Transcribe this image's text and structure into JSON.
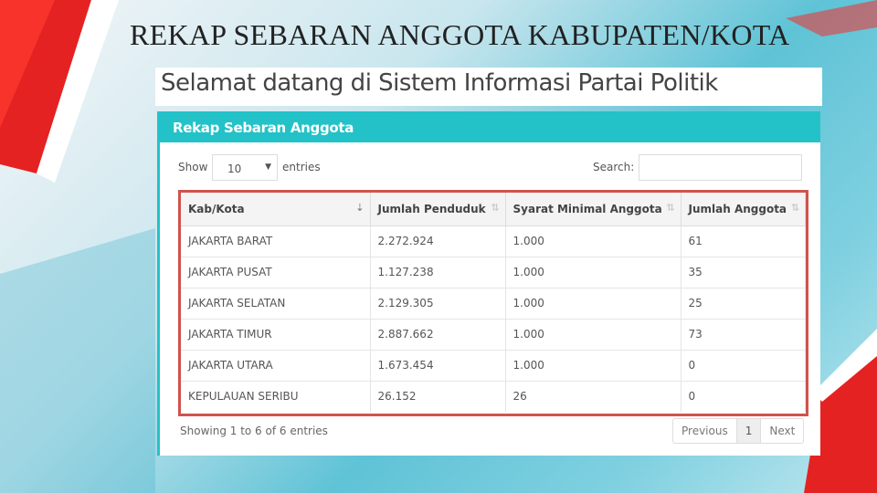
{
  "slide_title": "REKAP SEBARAN ANGGOTA  KABUPATEN/KOTA",
  "welcome": "Selamat datang di Sistem Informasi Partai Politik",
  "panel": {
    "title": "Rekap Sebaran Anggota",
    "show_label": "Show",
    "page_size": "10",
    "entries_label": "entries",
    "search_label": "Search:",
    "search_value": ""
  },
  "table": {
    "headers": [
      "Kab/Kota",
      "Jumlah Penduduk",
      "Syarat Minimal Anggota",
      "Jumlah Anggota"
    ],
    "rows": [
      [
        "JAKARTA BARAT",
        "2.272.924",
        "1.000",
        "61"
      ],
      [
        "JAKARTA PUSAT",
        "1.127.238",
        "1.000",
        "35"
      ],
      [
        "JAKARTA SELATAN",
        "2.129.305",
        "1.000",
        "25"
      ],
      [
        "JAKARTA TIMUR",
        "2.887.662",
        "1.000",
        "73"
      ],
      [
        "JAKARTA UTARA",
        "1.673.454",
        "1.000",
        "0"
      ],
      [
        "KEPULAUAN SERIBU",
        "26.152",
        "26",
        "0"
      ]
    ]
  },
  "footer": {
    "info": "Showing 1 to 6 of 6 entries",
    "previous": "Previous",
    "page": "1",
    "next": "Next"
  },
  "colors": {
    "accent": "#23c2c8",
    "highlight": "#d0534d",
    "decor_red": "#e02020"
  }
}
